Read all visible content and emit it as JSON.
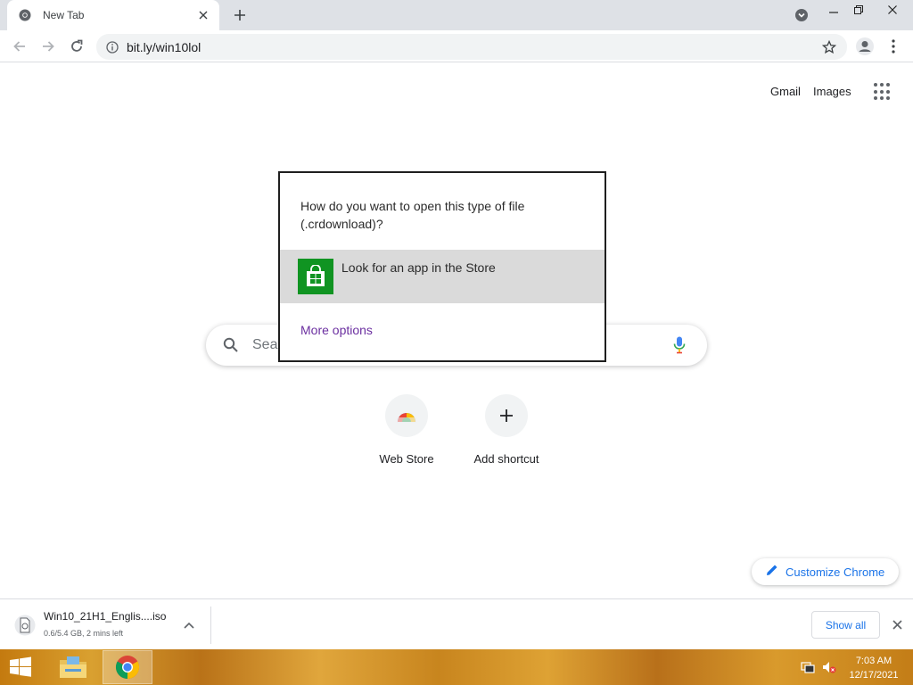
{
  "browser": {
    "tab_title": "New Tab",
    "url": "bit.ly/win10lol"
  },
  "ntp": {
    "gmail_label": "Gmail",
    "images_label": "Images",
    "search_placeholder": "Sear",
    "shortcuts": [
      {
        "label": "Web Store",
        "icon": "web-store-icon"
      },
      {
        "label": "Add shortcut",
        "icon": "plus-icon"
      }
    ],
    "customize_label": "Customize Chrome"
  },
  "dialog": {
    "question": "How do you want to open this type of file (.crdownload)?",
    "option_label": "Look for an app in the Store",
    "more_options": "More options"
  },
  "download": {
    "filename": "Win10_21H1_Englis....iso",
    "status": "0.6/5.4 GB, 2 mins left",
    "show_all": "Show all"
  },
  "taskbar": {
    "time": "7:03 AM",
    "date": "12/17/2021"
  },
  "colors": {
    "store_green": "#109422",
    "link_blue": "#1a73e8",
    "more_options_purple": "#6b2fa0"
  }
}
